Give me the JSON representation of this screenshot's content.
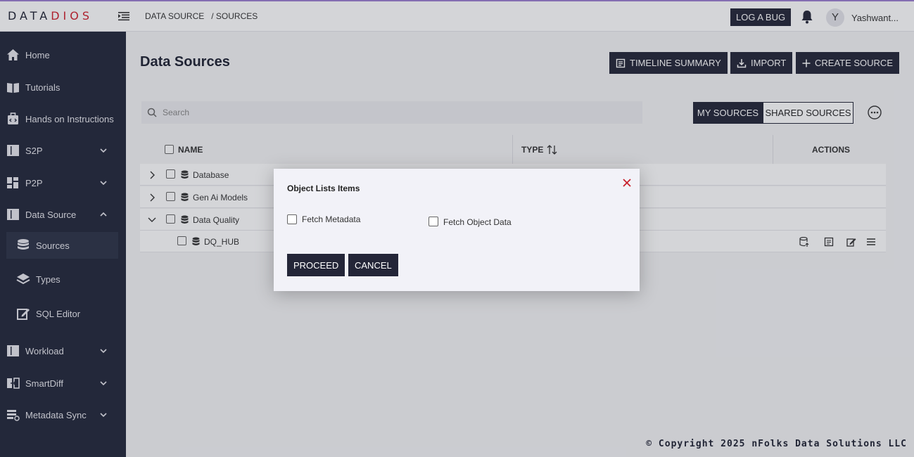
{
  "brand": {
    "logo_text_a": "DATA",
    "logo_text_b": "DIOS"
  },
  "breadcrumb": [
    "DATA SOURCE",
    "/ SOURCES"
  ],
  "header": {
    "log_bug": "LOG A BUG",
    "avatar_letter": "Y",
    "username": "Yashwant..."
  },
  "sidebar": {
    "items": [
      {
        "label": "Home",
        "icon": "home-icon"
      },
      {
        "label": "Tutorials",
        "icon": "book-icon"
      },
      {
        "label": "Hands on Instructions",
        "icon": "toolbox-icon"
      },
      {
        "label": "S2P",
        "icon": "columns-icon"
      },
      {
        "label": "P2P",
        "icon": "grid-icon"
      },
      {
        "label": "Data Source",
        "icon": "columns-icon"
      },
      {
        "label": "Workload",
        "icon": "columns-icon"
      },
      {
        "label": "SmartDiff",
        "icon": "compare-icon"
      },
      {
        "label": "Metadata Sync",
        "icon": "sync-icon"
      }
    ],
    "sub_items": [
      {
        "label": "Sources",
        "icon": "database-icon"
      },
      {
        "label": "Types",
        "icon": "layers-icon"
      },
      {
        "label": "SQL Editor",
        "icon": "edit-icon"
      }
    ]
  },
  "main": {
    "title": "Data Sources",
    "buttons": {
      "timeline": "TIMELINE SUMMARY",
      "import": "IMPORT",
      "create": "CREATE SOURCE"
    },
    "search_placeholder": "Search",
    "tabs": {
      "mine": "MY SOURCES",
      "shared": "SHARED SOURCES"
    },
    "columns": {
      "name": "NAME",
      "type": "TYPE",
      "actions": "ACTIONS"
    },
    "rows": [
      {
        "label": "Database",
        "expanded": false
      },
      {
        "label": "Gen Ai Models",
        "expanded": false
      },
      {
        "label": "Data Quality",
        "expanded": true
      },
      {
        "label": "DQ_HUB",
        "child": true
      }
    ]
  },
  "modal": {
    "title": "Object Lists Items",
    "option_a": "Fetch Metadata",
    "option_b": "Fetch Object Data",
    "proceed": "PROCEED",
    "cancel": "CANCEL"
  },
  "footer": {
    "copyright": "© Copyright 2025 nFolks Data Solutions LLC"
  },
  "colors": {
    "dark": "#242638",
    "sidebar": "#22273a",
    "accent_red": "#d0202c",
    "topline": "#9b7fd0"
  }
}
